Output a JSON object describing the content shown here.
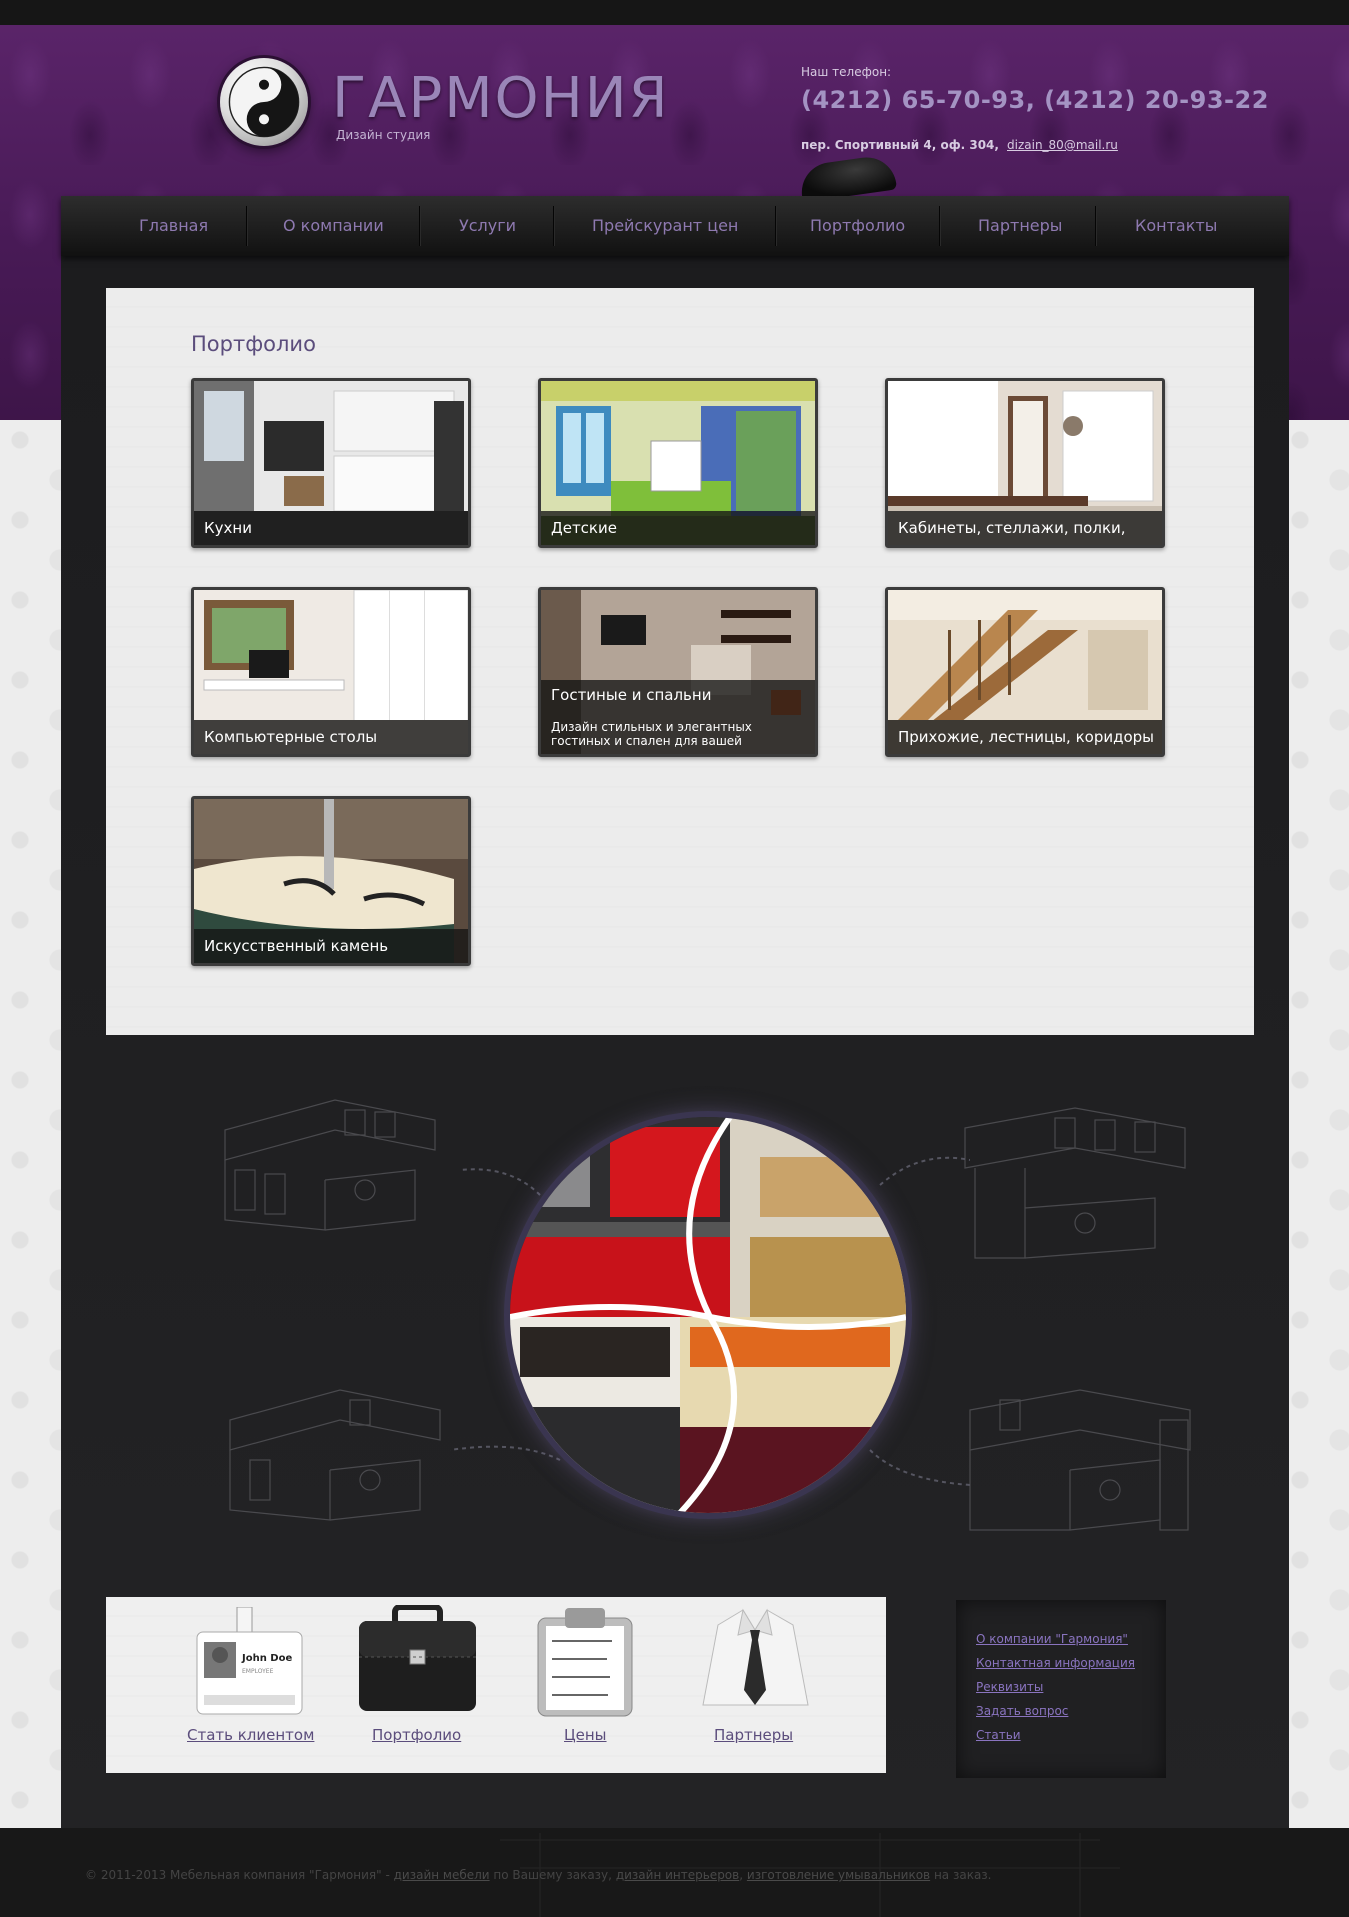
{
  "header": {
    "brand": "ГАРМОНИЯ",
    "brand_sub": "Дизайн студия",
    "phone_label": "Наш телефон:",
    "phones": "(4212) 65-70-93,  (4212) 20-93-22",
    "address": "пер. Спортивный 4, оф. 304,",
    "email": "dizain_80@mail.ru"
  },
  "nav": {
    "items": [
      {
        "label": "Главная"
      },
      {
        "label": "О компании"
      },
      {
        "label": "Услуги"
      },
      {
        "label": "Прейскурант цен"
      },
      {
        "label": "Портфолио"
      },
      {
        "label": "Партнеры"
      },
      {
        "label": "Контакты"
      }
    ]
  },
  "main": {
    "title": "Портфолио",
    "cards": [
      {
        "label": "Кухни"
      },
      {
        "label": "Детские"
      },
      {
        "label": "Кабинеты, стеллажи, полки,"
      },
      {
        "label": "Компьютерные столы"
      },
      {
        "label": "Гостиные и спальни",
        "description": "Дизайн стильных и элегантных гостиных и спален для вашей"
      },
      {
        "label": "Прихожие, лестницы, коридоры"
      },
      {
        "label": "Искусственный камень"
      }
    ]
  },
  "features": {
    "items": [
      {
        "label": "Стать клиентом",
        "badge_name": "John Doe",
        "badge_role": "EMPLOYEE"
      },
      {
        "label": "Портфолио"
      },
      {
        "label": "Цены"
      },
      {
        "label": "Партнеры"
      }
    ]
  },
  "sidebar": {
    "links": [
      {
        "label": "О компании \"Гармония\""
      },
      {
        "label": "Контактная информация"
      },
      {
        "label": "Реквизиты"
      },
      {
        "label": "Задать вопрос"
      },
      {
        "label": "Статьи"
      }
    ]
  },
  "footer": {
    "prefix": "© 2011-2013 Мебельная компания \"Гармония\" -",
    "link1": "дизайн мебели",
    "mid1": "по Вашему заказу,",
    "link2": "дизайн интерьеров",
    "sep": ",",
    "link3": "изготовление умывальников",
    "suffix": "на заказ."
  },
  "colors": {
    "header_purple": "#4a1b59",
    "accent_lavender": "#9a86b8",
    "link_purple": "#5b4d7c",
    "dark_bg": "#1e1e20"
  }
}
